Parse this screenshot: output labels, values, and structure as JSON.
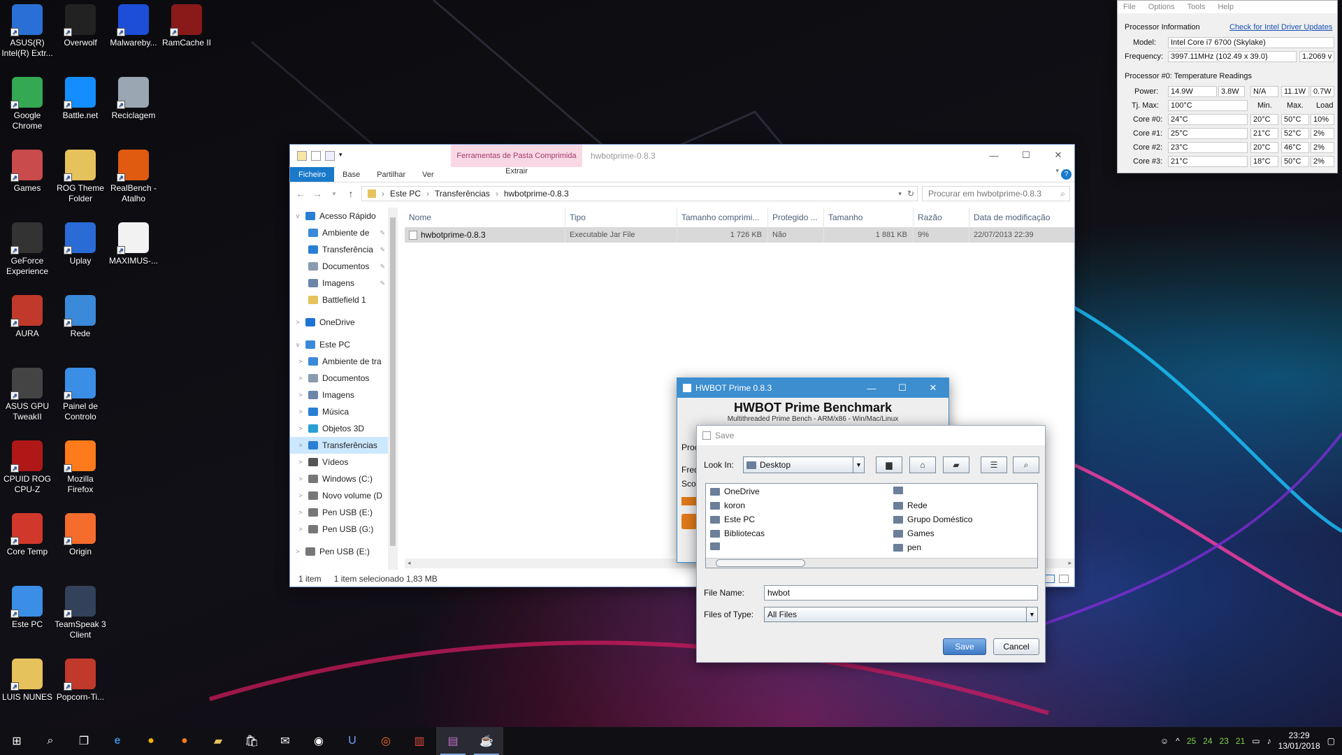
{
  "desktop": {
    "icons": [
      {
        "label": "ASUS(R)\nIntel(R) Extr...",
        "icon": "asus-intel-icon",
        "color": "#2a6fd6"
      },
      {
        "label": "Overwolf",
        "icon": "overwolf-icon",
        "color": "#222"
      },
      {
        "label": "Malwareby...",
        "icon": "malwarebytes-icon",
        "color": "#1d4ed8"
      },
      {
        "label": "RamCache II",
        "icon": "ramcache-icon",
        "color": "#8a1a1a"
      },
      {
        "label": "Google\nChrome",
        "icon": "chrome-icon",
        "color": "#34a853"
      },
      {
        "label": "Battle.net",
        "icon": "battlenet-icon",
        "color": "#148eff"
      },
      {
        "label": "Reciclagem",
        "icon": "recycle-bin-icon",
        "color": "#9aa6b2"
      },
      {
        "label": "Games",
        "icon": "games-icon",
        "color": "#c94b4b"
      },
      {
        "label": "ROG Theme\nFolder",
        "icon": "folder-icon",
        "color": "#e6c25c"
      },
      {
        "label": "RealBench -\nAtalho",
        "icon": "realbench-icon",
        "color": "#e05a10"
      },
      {
        "label": "GeForce\nExperience",
        "icon": "geforce-icon",
        "color": "#333"
      },
      {
        "label": "Uplay",
        "icon": "uplay-icon",
        "color": "#2a6bd6"
      },
      {
        "label": "MAXIMUS-...",
        "icon": "document-icon",
        "color": "#f2f2f2"
      },
      {
        "label": "AURA",
        "icon": "aura-icon",
        "color": "#c0392b"
      },
      {
        "label": "Rede",
        "icon": "network-icon",
        "color": "#3b8ad9"
      },
      {
        "label": "ASUS GPU\nTweakII",
        "icon": "gpu-tweak-icon",
        "color": "#444"
      },
      {
        "label": "Painel de\nControlo",
        "icon": "control-panel-icon",
        "color": "#3a8ee6"
      },
      {
        "label": "CPUID ROG\nCPU-Z",
        "icon": "cpuz-icon",
        "color": "#b01818"
      },
      {
        "label": "Mozilla\nFirefox",
        "icon": "firefox-icon",
        "color": "#ff7a1a"
      },
      {
        "label": "Core Temp",
        "icon": "coretemp-icon",
        "color": "#d0382b"
      },
      {
        "label": "Origin",
        "icon": "origin-icon",
        "color": "#f56c2d"
      },
      {
        "label": "Este PC",
        "icon": "computer-icon",
        "color": "#3a8ee6"
      },
      {
        "label": "TeamSpeak 3\nClient",
        "icon": "teamspeak-icon",
        "color": "#33415a"
      },
      {
        "label": "LUIS NUNES",
        "icon": "user-folder-icon",
        "color": "#e6c25c"
      },
      {
        "label": "Popcorn-Ti...",
        "icon": "popcorn-icon",
        "color": "#c0392b"
      }
    ]
  },
  "explorer": {
    "tools_tab": "Ferramentas de Pasta Comprimida",
    "title": "hwbotprime-0.8.3",
    "ribbon": [
      "Ficheiro",
      "Base",
      "Partilhar",
      "Ver"
    ],
    "extract": "Extrair",
    "breadcrumb": [
      "Este PC",
      "Transferências",
      "hwbotprime-0.8.3"
    ],
    "search_placeholder": "Procurar em hwbotprime-0.8.3",
    "nav": [
      {
        "label": "Acesso Rápido",
        "level": 0,
        "expand": "v",
        "icon": "star-icon",
        "color": "#2a7fd4"
      },
      {
        "label": "Ambiente de",
        "level": 1,
        "pin": true,
        "icon": "desktop-icon",
        "color": "#3b8ad9"
      },
      {
        "label": "Transferência",
        "level": 1,
        "pin": true,
        "icon": "download-icon",
        "color": "#2a7fd4"
      },
      {
        "label": "Documentos",
        "level": 1,
        "pin": true,
        "icon": "documents-icon",
        "color": "#8a9bb0"
      },
      {
        "label": "Imagens",
        "level": 1,
        "pin": true,
        "icon": "pictures-icon",
        "color": "#6b86a8"
      },
      {
        "label": "Battlefield 1",
        "level": 1,
        "icon": "folder-icon",
        "color": "#e6c25c"
      },
      {
        "label": "OneDrive",
        "level": 0,
        "expand": ">",
        "icon": "cloud-icon",
        "color": "#1e73d6"
      },
      {
        "label": "Este PC",
        "level": 0,
        "expand": "v",
        "icon": "computer-icon",
        "color": "#3b8ad9"
      },
      {
        "label": "Ambiente de tra",
        "level": 1,
        "expand": ">",
        "icon": "desktop-icon",
        "color": "#3b8ad9"
      },
      {
        "label": "Documentos",
        "level": 1,
        "expand": ">",
        "icon": "documents-icon",
        "color": "#8a9bb0"
      },
      {
        "label": "Imagens",
        "level": 1,
        "expand": ">",
        "icon": "pictures-icon",
        "color": "#6b86a8"
      },
      {
        "label": "Música",
        "level": 1,
        "expand": ">",
        "icon": "music-icon",
        "color": "#2a7fd4"
      },
      {
        "label": "Objetos 3D",
        "level": 1,
        "expand": ">",
        "icon": "cube-icon",
        "color": "#2aa0d4"
      },
      {
        "label": "Transferências",
        "level": 1,
        "expand": ">",
        "icon": "download-icon",
        "color": "#2a7fd4",
        "selected": true
      },
      {
        "label": "Vídeos",
        "level": 1,
        "expand": ">",
        "icon": "video-icon",
        "color": "#555"
      },
      {
        "label": "Windows (C:)",
        "level": 1,
        "expand": ">",
        "icon": "drive-icon",
        "color": "#777"
      },
      {
        "label": "Novo volume (D",
        "level": 1,
        "expand": ">",
        "icon": "drive-icon",
        "color": "#777"
      },
      {
        "label": "Pen USB (E:)",
        "level": 1,
        "expand": ">",
        "icon": "usb-icon",
        "color": "#777"
      },
      {
        "label": "Pen USB (G:)",
        "level": 1,
        "expand": ">",
        "icon": "usb-icon",
        "color": "#777"
      },
      {
        "label": "Pen USB (E:)",
        "level": 0,
        "expand": ">",
        "icon": "usb-icon",
        "color": "#777"
      }
    ],
    "columns": [
      "Nome",
      "Tipo",
      "Tamanho comprimi...",
      "Protegido ...",
      "Tamanho",
      "Razão",
      "Data de modificação"
    ],
    "rows": [
      [
        "hwbotprime-0.8.3",
        "Executable Jar File",
        "1 726 KB",
        "Não",
        "1 881 KB",
        "9%",
        "22/07/2013 22:39"
      ]
    ],
    "status_count": "1 item",
    "status_selected": "1 item selecionado 1,83 MB"
  },
  "hwbot": {
    "title": "HWBOT Prime 0.8.3",
    "heading": "HWBOT Prime Benchmark",
    "subtitle": "Multithreaded Prime Bench - ARM/x86 - Win/Mac/Linux",
    "labels": [
      "Proc",
      "Freq",
      "Sco"
    ]
  },
  "save_dialog": {
    "title": "Save",
    "look_in_label": "Look In:",
    "look_in_value": "Desktop",
    "files_col1": [
      "OneDrive",
      "koron",
      "Este PC",
      "Bibliotecas",
      ""
    ],
    "files_col2": [
      "",
      "Rede",
      "Grupo Doméstico",
      "Games",
      "pen"
    ],
    "file_name_label": "File Name:",
    "file_name_value": "hwbot",
    "files_type_label": "Files of Type:",
    "files_type_value": "All Files",
    "save": "Save",
    "cancel": "Cancel"
  },
  "cpu_panel": {
    "menu": [
      "File",
      "Options",
      "Tools",
      "Help"
    ],
    "section1": "Processor Information",
    "update_link": "Check for Intel Driver Updates",
    "model_label": "Model:",
    "model": "Intel Core i7 6700 (Skylake)",
    "freq_label": "Frequency:",
    "freq": "3997.11MHz (102.49 x 39.0)",
    "voltage": "1.2069 v",
    "section2": "Processor #0: Temperature Readings",
    "power_label": "Power:",
    "power": [
      "14.9W",
      "3.8W",
      "N/A",
      "11.1W",
      "0.7W"
    ],
    "tjmax_label": "Tj. Max:",
    "tjmax": "100°C",
    "heads": [
      "Min.",
      "Max.",
      "Load"
    ],
    "cores": [
      {
        "label": "Core #0:",
        "temp": "24°C",
        "min": "20°C",
        "max": "50°C",
        "load": "10%"
      },
      {
        "label": "Core #1:",
        "temp": "25°C",
        "min": "21°C",
        "max": "52°C",
        "load": "2%"
      },
      {
        "label": "Core #2:",
        "temp": "23°C",
        "min": "20°C",
        "max": "46°C",
        "load": "2%"
      },
      {
        "label": "Core #3:",
        "temp": "21°C",
        "min": "18°C",
        "max": "50°C",
        "load": "2%"
      }
    ]
  },
  "taskbar": {
    "temps": [
      "25",
      "24",
      "23",
      "21"
    ],
    "time": "23:29",
    "date": "13/01/2018"
  }
}
